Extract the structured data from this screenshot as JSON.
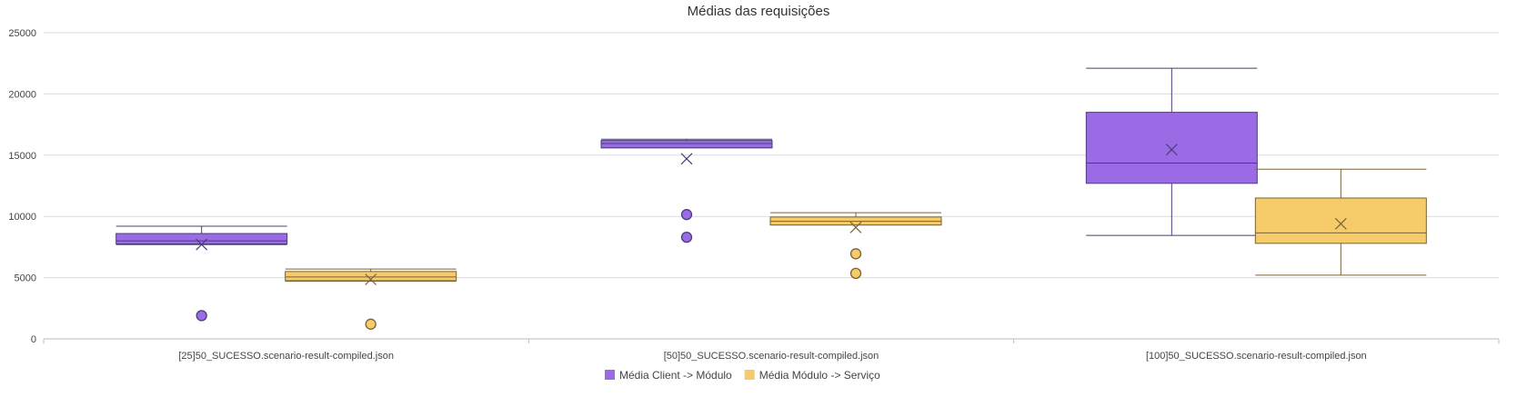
{
  "chart_data": {
    "type": "box",
    "title": "Médias das requisições",
    "categories": [
      "[25]50_SUCESSO.scenario-result-compiled.json",
      "[50]50_SUCESSO.scenario-result-compiled.json",
      "[100]50_SUCESSO.scenario-result-compiled.json"
    ],
    "ylim": [
      0,
      25000
    ],
    "yticks": [
      "0",
      "5000",
      "10000",
      "15000",
      "20000",
      "25000"
    ],
    "grid": true,
    "legend_position": "bottom",
    "series": [
      {
        "name": "Média Client -> Módulo",
        "color": "#9b6be5",
        "stroke": "#4b3c7a",
        "boxes": [
          {
            "min": 7700,
            "q1": 7750,
            "median": 8000,
            "q3": 8600,
            "max": 9200,
            "mean": 7700,
            "outliers": [
              1900
            ]
          },
          {
            "min": 15600,
            "q1": 15600,
            "median": 15950,
            "q3": 16200,
            "max": 16300,
            "mean": 14700,
            "outliers": [
              10150,
              8300
            ]
          },
          {
            "min": 8450,
            "q1": 12700,
            "median": 14350,
            "q3": 18500,
            "max": 22100,
            "mean": 15450,
            "outliers": []
          }
        ]
      },
      {
        "name": "Média Módulo -> Serviço",
        "color": "#f6cb6a",
        "stroke": "#7a6234",
        "boxes": [
          {
            "min": 4700,
            "q1": 4750,
            "median": 5050,
            "q3": 5500,
            "max": 5700,
            "mean": 4850,
            "outliers": [
              1200
            ]
          },
          {
            "min": 9300,
            "q1": 9300,
            "median": 9600,
            "q3": 9950,
            "max": 10300,
            "mean": 9100,
            "outliers": [
              6950,
              5350
            ]
          },
          {
            "min": 5200,
            "q1": 7800,
            "median": 8650,
            "q3": 11500,
            "max": 13850,
            "mean": 9400,
            "outliers": []
          }
        ]
      }
    ]
  }
}
